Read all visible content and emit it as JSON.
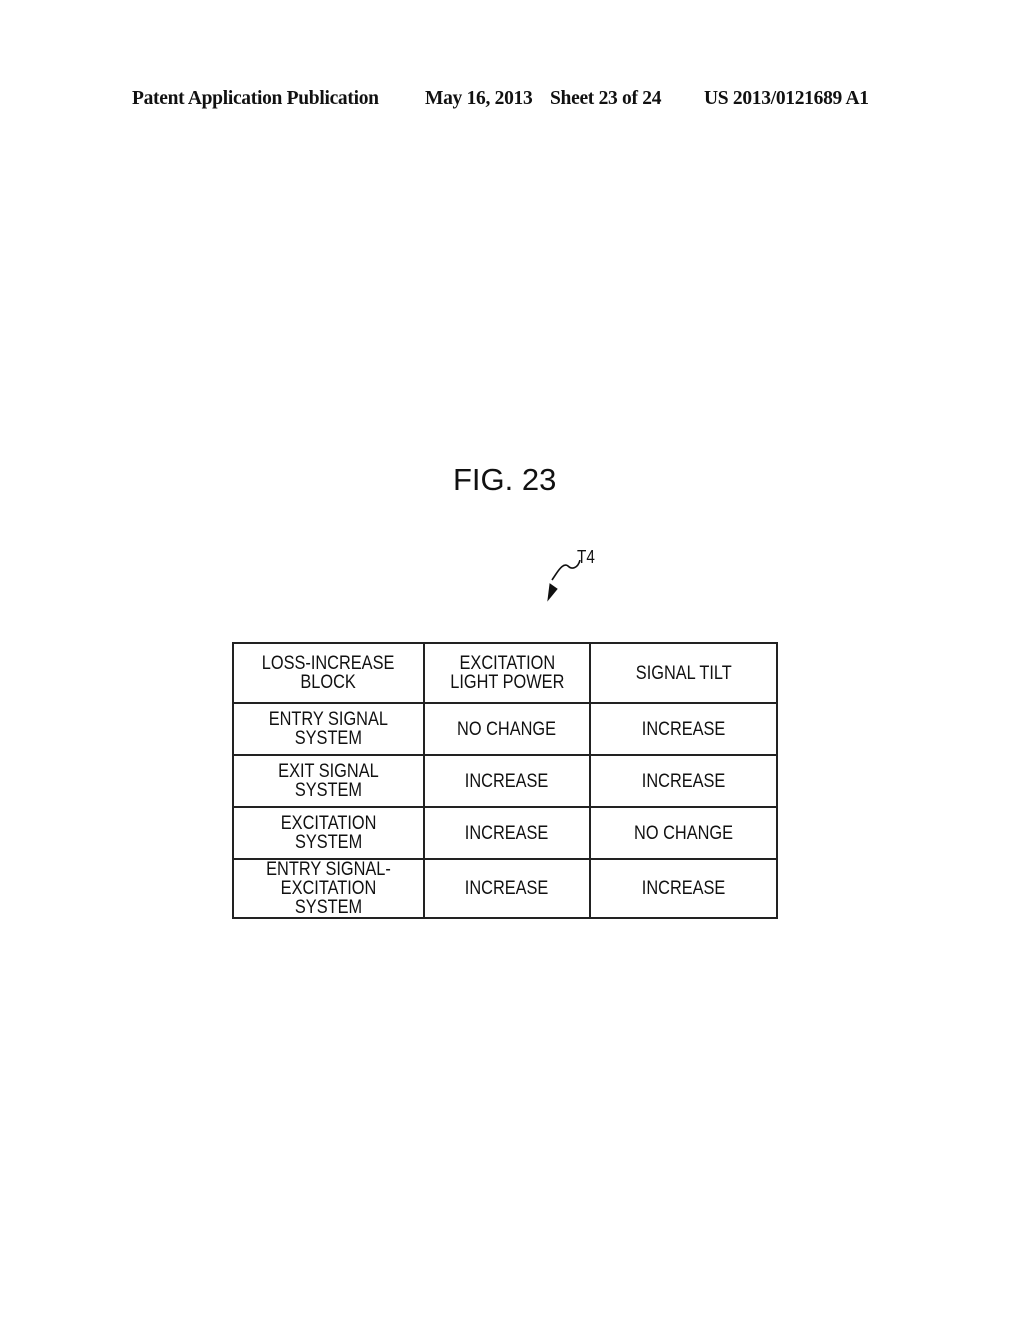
{
  "header": {
    "publication": "Patent Application Publication",
    "date": "May 16, 2013",
    "sheet": "Sheet 23 of 24",
    "number": "US 2013/0121689 A1"
  },
  "figure": {
    "title": "FIG. 23",
    "reference_label": "T4",
    "reference_icon": "squiggle-arrow-icon"
  },
  "table": {
    "headers": [
      "LOSS-INCREASE\nBLOCK",
      "EXCITATION\nLIGHT POWER",
      "SIGNAL TILT"
    ],
    "rows": [
      [
        "ENTRY SIGNAL\nSYSTEM",
        "NO CHANGE",
        "INCREASE"
      ],
      [
        "EXIT SIGNAL\nSYSTEM",
        "INCREASE",
        "INCREASE"
      ],
      [
        "EXCITATION\nSYSTEM",
        "INCREASE",
        "NO CHANGE"
      ],
      [
        "ENTRY SIGNAL-\nEXCITATION SYSTEM",
        "INCREASE",
        "INCREASE"
      ]
    ]
  }
}
